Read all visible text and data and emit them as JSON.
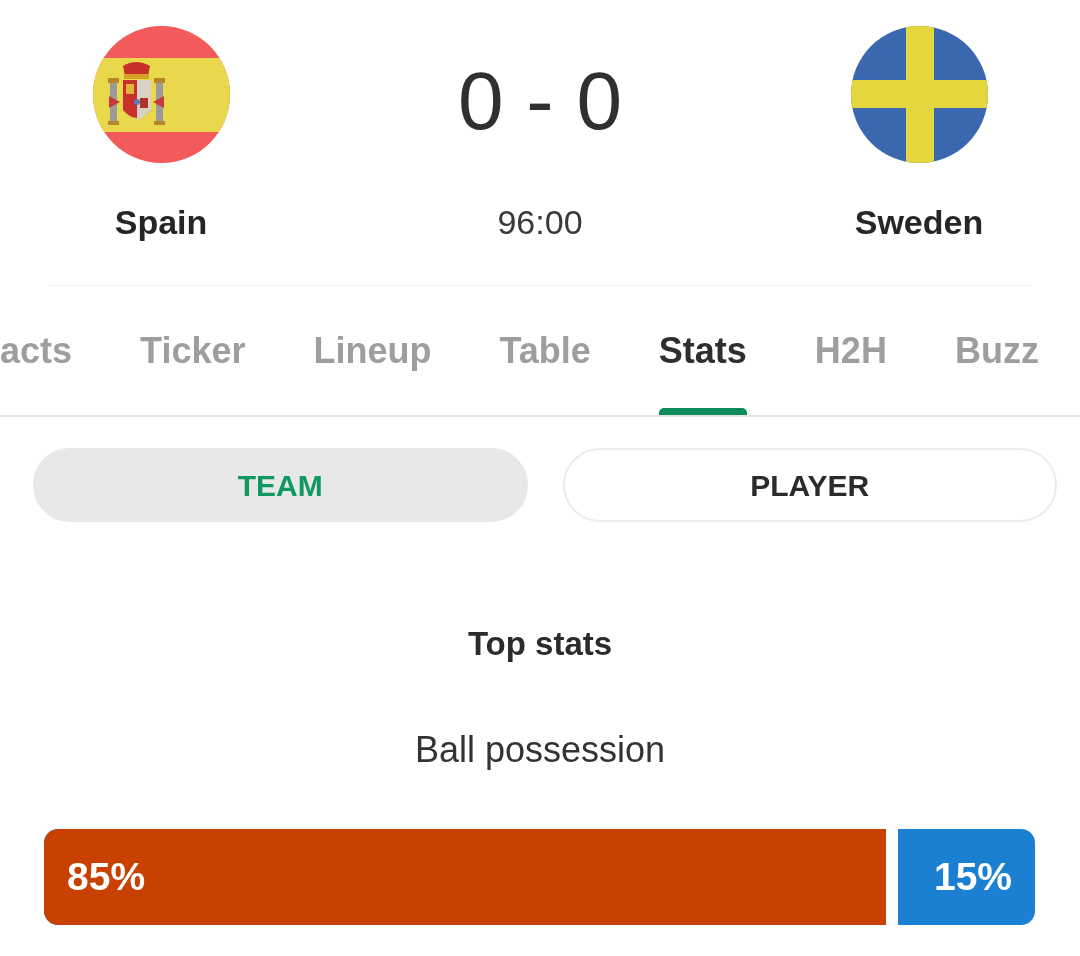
{
  "match": {
    "home": {
      "name": "Spain"
    },
    "score": "0 - 0",
    "time": "96:00",
    "away": {
      "name": "Sweden"
    }
  },
  "tabs": [
    {
      "label": "acts",
      "selected": false
    },
    {
      "label": "Ticker",
      "selected": false
    },
    {
      "label": "Lineup",
      "selected": false
    },
    {
      "label": "Table",
      "selected": false
    },
    {
      "label": "Stats",
      "selected": true
    },
    {
      "label": "H2H",
      "selected": false
    },
    {
      "label": "Buzz",
      "selected": false
    }
  ],
  "view_toggle": [
    {
      "label": "TEAM",
      "selected": true
    },
    {
      "label": "PLAYER",
      "selected": false
    }
  ],
  "section_title": "Top stats",
  "stats": [
    {
      "label": "Ball possession",
      "level": 0.85,
      "segments": [
        {
          "value": "85%",
          "color": "#c94100"
        },
        {
          "value": "15%",
          "color": "#1b80d1"
        }
      ]
    }
  ]
}
